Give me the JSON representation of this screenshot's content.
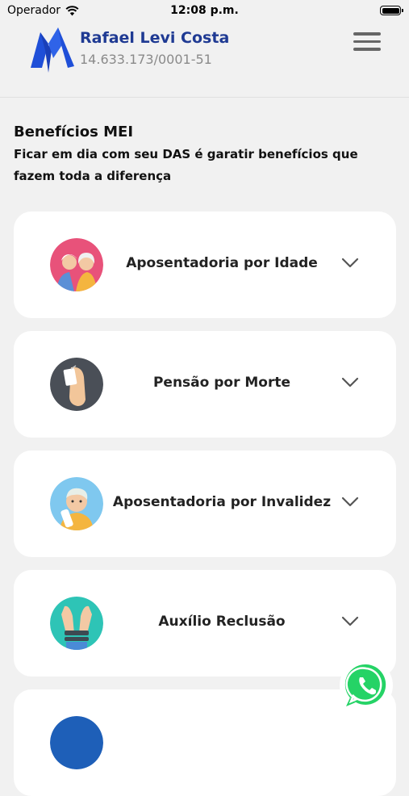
{
  "status_bar": {
    "carrier": "Operador",
    "time": "12:08 p.m."
  },
  "header": {
    "company_name": "Rafael Levi Costa",
    "company_id": "14.633.173/0001-51",
    "brand_color": "#1f3a93"
  },
  "section": {
    "title": "Benefícios MEI",
    "subtitle": "Ficar em dia com seu DAS é garatir benefícios que fazem toda a diferença"
  },
  "benefits": [
    {
      "label": "Aposentadoria por Idade",
      "icon": "elderly-couple-icon"
    },
    {
      "label": "Pensão por Morte",
      "icon": "toe-tag-icon"
    },
    {
      "label": "Aposentadoria por Invalidez",
      "icon": "injured-person-icon"
    },
    {
      "label": "Auxílio Reclusão",
      "icon": "handcuffed-hands-icon"
    },
    {
      "label": "",
      "icon": "blue-circle-icon"
    }
  ],
  "floating": {
    "icon": "whatsapp-icon"
  }
}
